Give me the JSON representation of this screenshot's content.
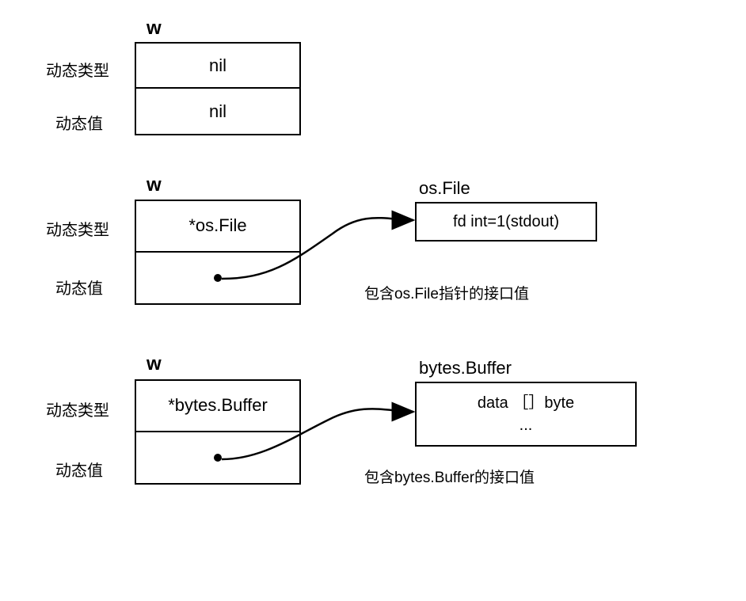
{
  "diagram": {
    "labels": {
      "w": "w",
      "dynType": "动态类型",
      "dynValue": "动态值"
    },
    "block1": {
      "typeCell": "nil",
      "valueCell": "nil"
    },
    "block2": {
      "typeCell": "*os.File",
      "valueCell": "",
      "targetTitle": "os.File",
      "targetContent": "fd int=1(stdout)",
      "caption": "包含os.File指针的接口值"
    },
    "block3": {
      "typeCell": "*bytes.Buffer",
      "valueCell": "",
      "targetTitle": "bytes.Buffer",
      "targetLine1": "data ［］byte",
      "targetLine2": "...",
      "caption": "包含bytes.Buffer的接口值"
    }
  }
}
